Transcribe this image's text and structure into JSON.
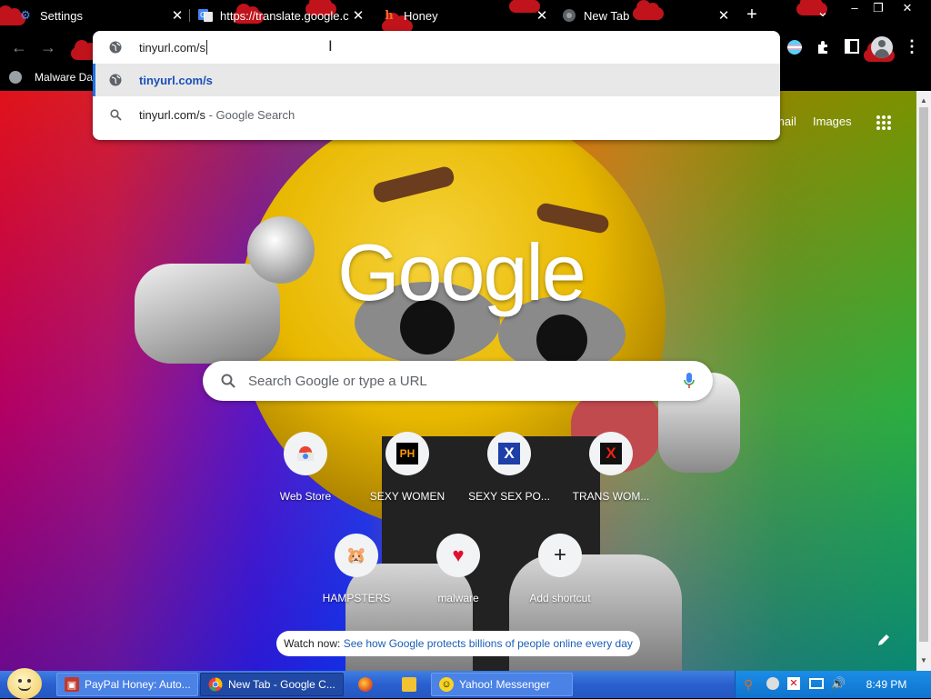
{
  "browser": {
    "tabs": [
      {
        "title": "Settings",
        "icon": "gear-icon",
        "icon_color": "#4d8ef7",
        "close": "✕"
      },
      {
        "title": "https://translate.google.c",
        "icon": "google-translate-icon",
        "icon_color": "#4285f4",
        "close": "✕"
      },
      {
        "title": "Honey",
        "icon": "honey-icon",
        "icon_color": "#f26c25",
        "close": "✕"
      },
      {
        "title": "New Tab",
        "icon": "chrome-icon",
        "icon_color": "#9aa0a6",
        "close": "✕"
      }
    ],
    "new_tab_symbol": "+",
    "tab_search_symbol": "⌄",
    "window_controls": {
      "minimize": "–",
      "restore": "❐",
      "close": "✕"
    },
    "toolbar": {
      "back": "←",
      "forward": "→",
      "profile_icon": "avatar-icon",
      "extensions_icon": "puzzle-icon",
      "menu": "⋮"
    },
    "bookmarks": [
      {
        "label": "Malware Da",
        "icon": "globe-icon"
      }
    ],
    "omnibox": {
      "input_value": "tinyurl.com/s",
      "suggestions": [
        {
          "text": "tinyurl.com/s",
          "suffix": "",
          "icon": "globe-icon",
          "highlighted": true
        },
        {
          "text": "tinyurl.com/s",
          "suffix": " - Google Search",
          "icon": "search-icon",
          "highlighted": false
        }
      ]
    }
  },
  "ntp": {
    "top_links": {
      "gmail": "mail",
      "images": "Images"
    },
    "logo": "Google",
    "search_placeholder": "Search Google or type a URL",
    "shortcuts_row1": [
      {
        "label": "Web Store",
        "icon": "webstore-icon",
        "glyph": ""
      },
      {
        "label": "SEXY WOMEN",
        "icon": "ph-icon",
        "glyph": "PH"
      },
      {
        "label": "SEXY SEX PO...",
        "icon": "x-icon",
        "glyph": "X"
      },
      {
        "label": "TRANS WOM...",
        "icon": "x-red-icon",
        "glyph": "X"
      }
    ],
    "shortcuts_row2": [
      {
        "label": "HAMPSTERS",
        "icon": "hamster-icon",
        "glyph": "🐹"
      },
      {
        "label": "malware",
        "icon": "heart-icon",
        "glyph": "♥"
      },
      {
        "label": "Add shortcut",
        "icon": "plus-icon",
        "glyph": "+"
      }
    ],
    "watch_now": {
      "prefix": "Watch now: ",
      "link": "See how Google protects billions of people online every day"
    },
    "customize_icon": "pencil-icon",
    "colors": {
      "gradient_left": "#c6002f",
      "gradient_right": "#10e800",
      "emoji_yellow": "#e8b800"
    }
  },
  "taskbar": {
    "tasks": [
      {
        "label": "PayPal Honey: Auto...",
        "icon": "paypal-icon"
      },
      {
        "label": "New Tab - Google C...",
        "icon": "chrome-icon",
        "active": true
      },
      {
        "label": "",
        "icon": "firefox-icon"
      },
      {
        "label": "",
        "icon": "folder-icon"
      },
      {
        "label": "Yahoo! Messenger",
        "icon": "yahoo-messenger-icon"
      }
    ],
    "clock": "8:49 PM"
  }
}
